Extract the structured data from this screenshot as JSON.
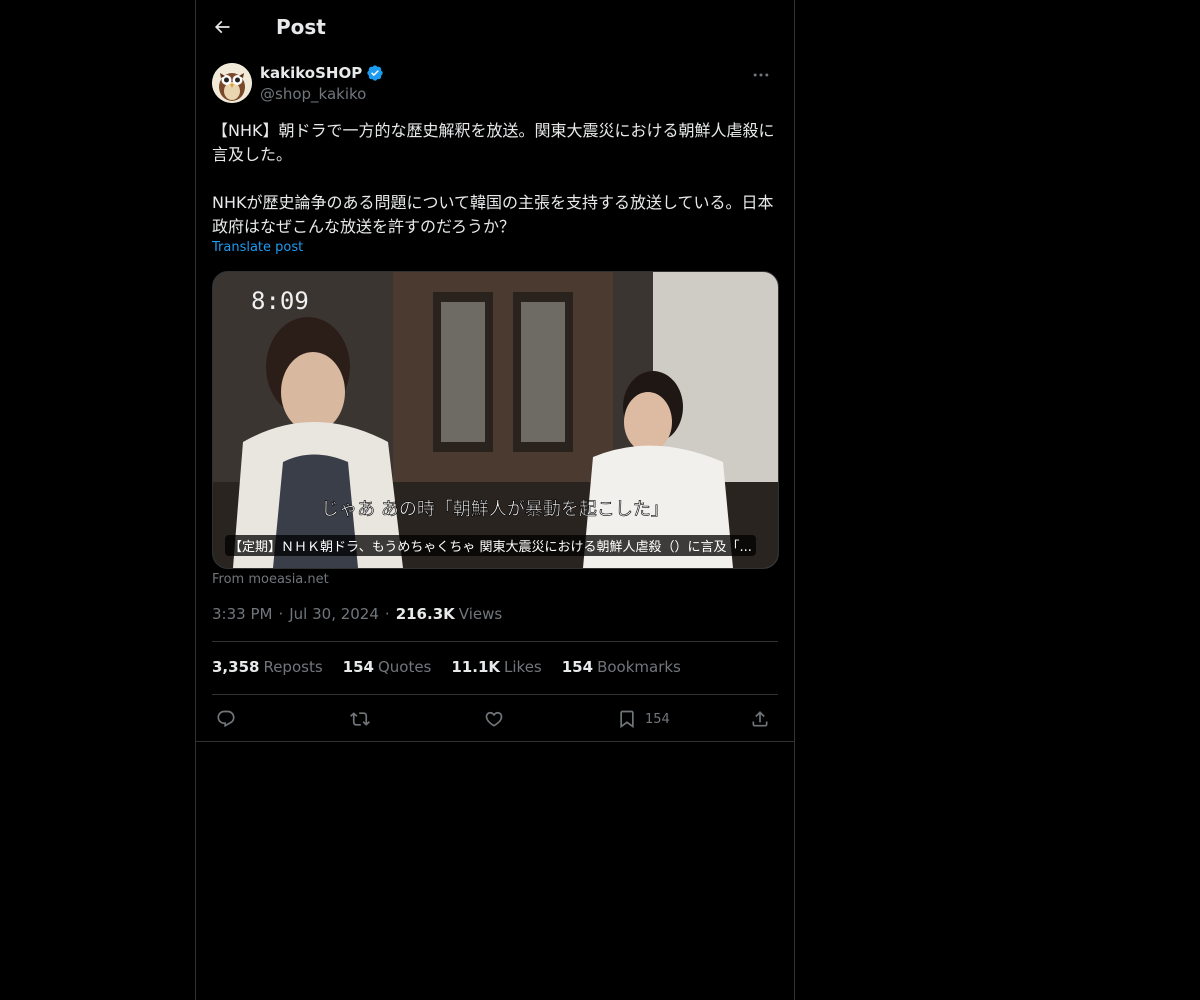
{
  "header": {
    "title": "Post"
  },
  "post": {
    "author": {
      "name": "kakikoSHOP",
      "handle": "@shop_kakiko",
      "verified": true
    },
    "text": "【NHK】朝ドラで一方的な歴史解釈を放送。関東大震災における朝鮮人虐殺に言及した。\n\nNHKが歴史論争のある問題について韓国の主張を支持する放送している。日本政府はなぜこんな放送を許すのだろうか？",
    "translate_label": "Translate post",
    "media": {
      "timestamp_overlay": "8:09",
      "subtitle": "じゃあ あの時「朝鮮人が暴動を起こした」",
      "caption": "【定期】ＮＨＫ朝ドラ、もうめちゃくちゃ 関東大震災における朝鮮人虐殺（）に言及「..."
    },
    "source": "From moeasia.net",
    "time": "3:33 PM",
    "date": "Jul 30, 2024",
    "views_count": "216.3K",
    "views_label": "Views",
    "stats": {
      "reposts_count": "3,358",
      "reposts_label": "Reposts",
      "quotes_count": "154",
      "quotes_label": "Quotes",
      "likes_count": "11.1K",
      "likes_label": "Likes",
      "bookmarks_count": "154",
      "bookmarks_label": "Bookmarks"
    },
    "actions": {
      "bookmark_count": "154"
    }
  },
  "colors": {
    "accent": "#1d9bf0",
    "muted": "#71767b",
    "text": "#e7e9ea",
    "border": "#2f3336"
  }
}
